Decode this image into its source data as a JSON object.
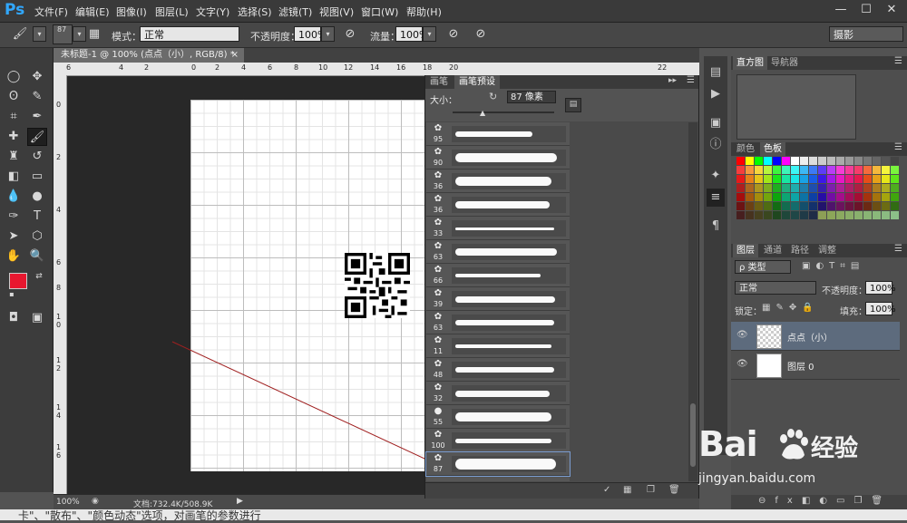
{
  "app": {
    "logo": "Ps",
    "menu": [
      "文件(F)",
      "编辑(E)",
      "图像(I)",
      "图层(L)",
      "文字(Y)",
      "选择(S)",
      "滤镜(T)",
      "视图(V)",
      "窗口(W)",
      "帮助(H)"
    ],
    "window_controls": [
      "—",
      "☐",
      "✕"
    ]
  },
  "options_bar": {
    "brush_size": "87",
    "mode_label": "模式：",
    "mode_value": "正常",
    "opacity_label": "不透明度：",
    "opacity_value": "100%",
    "flow_label": "流量：",
    "flow_value": "100%",
    "workspace": "摄影"
  },
  "document": {
    "tab_title": "未标题-1 @ 100% (点点（小）, RGB/8) *",
    "tab_close": "×",
    "ruler_top": [
      "6",
      "4",
      "2",
      "0",
      "2",
      "4",
      "6",
      "8",
      "10",
      "12",
      "14",
      "16",
      "18",
      "20",
      "22"
    ],
    "ruler_left": [
      "0",
      "2",
      "4",
      "6",
      "8",
      "1 0",
      "1 2",
      "1 4",
      "1 6"
    ],
    "zoom": "100%",
    "doc_info": "文档:732.4K/508.9K"
  },
  "brush_panel": {
    "tabs": [
      "画笔",
      "画笔预设"
    ],
    "size_label": "大小：",
    "size_value": "87 像素",
    "brushes": [
      {
        "num": "95"
      },
      {
        "num": "90"
      },
      {
        "num": "36"
      },
      {
        "num": "36"
      },
      {
        "num": "33"
      },
      {
        "num": "63"
      },
      {
        "num": "66"
      },
      {
        "num": "39"
      },
      {
        "num": "63"
      },
      {
        "num": "11"
      },
      {
        "num": "48"
      },
      {
        "num": "32"
      },
      {
        "num": "55"
      },
      {
        "num": "100"
      },
      {
        "num": "87"
      }
    ]
  },
  "right_panels": {
    "histogram_tabs": [
      "直方图",
      "导航器"
    ],
    "color_tabs": [
      "颜色",
      "色板"
    ],
    "layers_tabs": [
      "图层",
      "通道",
      "路径",
      "调整"
    ],
    "kind_label": "ρ 类型",
    "blend_mode": "正常",
    "opacity_label": "不透明度：",
    "opacity_value": "100%",
    "lock_label": "锁定：",
    "fill_label": "填充：",
    "fill_value": "100%",
    "layers": [
      {
        "name": "点点（小）",
        "selected": true
      },
      {
        "name": "图层 0",
        "selected": false
      }
    ]
  },
  "watermark": {
    "logo": "Bai",
    "logo2": "经验",
    "url": "jingyan.baidu.com"
  },
  "colors": {
    "foreground": "#e8172f",
    "background": "#000000"
  },
  "bottom_caption": "卡\"、\"散布\"、\"颜色动态\"选项，对画笔的参数进行"
}
